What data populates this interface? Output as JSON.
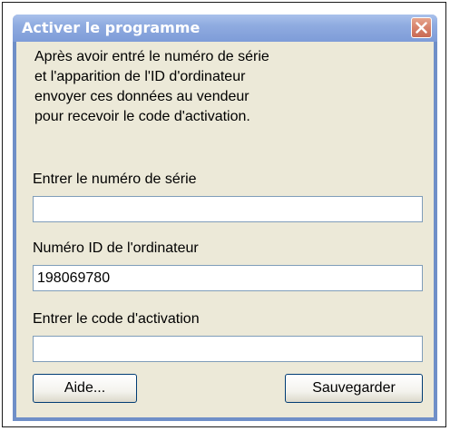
{
  "window": {
    "title": "Activer le programme",
    "close_icon": "close-x-icon",
    "accent_colors": {
      "titlebar": "#8fabe0",
      "close_button": "#d7826a",
      "body": "#ece9d8",
      "input_border": "#7f9db9"
    }
  },
  "description": {
    "lines": [
      "Après avoir entré le numéro de série",
      "et l'apparition de l'ID d'ordinateur",
      "envoyer ces données au vendeur",
      "pour recevoir le code d'activation."
    ]
  },
  "fields": {
    "serial": {
      "label": "Entrer le numéro de série",
      "value": ""
    },
    "computer_id": {
      "label": "Numéro ID de l'ordinateur",
      "value": "198069780"
    },
    "activation": {
      "label": "Entrer le code d'activation",
      "value": ""
    }
  },
  "buttons": {
    "help_label": "Aide...",
    "save_label": "Sauvegarder"
  }
}
